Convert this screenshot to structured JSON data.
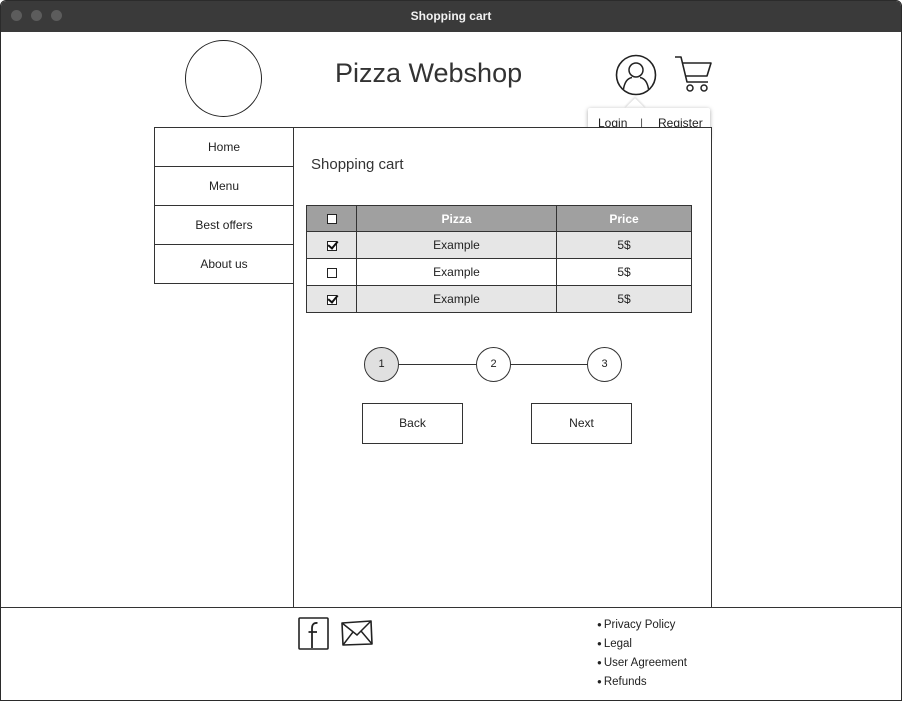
{
  "window": {
    "title": "Shopping cart"
  },
  "header": {
    "site_title": "Pizza Webshop",
    "icons": {
      "user": "user-icon",
      "cart": "cart-icon",
      "logo": "logo-placeholder"
    }
  },
  "account_popover": {
    "login": "Login",
    "separator": "|",
    "register": "Register"
  },
  "sidebar": {
    "items": [
      {
        "label": "Home"
      },
      {
        "label": "Menu"
      },
      {
        "label": "Best offers"
      },
      {
        "label": "About us"
      }
    ]
  },
  "main": {
    "title": "Shopping cart",
    "table": {
      "columns": [
        "",
        "Pizza",
        "Price"
      ],
      "header_checked": false,
      "rows": [
        {
          "checked": true,
          "pizza": "Example",
          "price": "5$"
        },
        {
          "checked": false,
          "pizza": "Example",
          "price": "5$"
        },
        {
          "checked": true,
          "pizza": "Example",
          "price": "5$"
        }
      ]
    },
    "stepper": {
      "steps": [
        "1",
        "2",
        "3"
      ],
      "current": 1
    },
    "buttons": {
      "back": "Back",
      "next": "Next"
    }
  },
  "footer": {
    "icons": {
      "facebook": "facebook-icon",
      "mail": "mail-icon"
    },
    "links": [
      "Privacy Policy",
      "Legal",
      "User Agreement",
      "Refunds"
    ]
  },
  "colors": {
    "titlebar": "#3a3a3a",
    "table_header": "#a0a0a0",
    "row_shade": "#e6e6e6",
    "active_step": "#e0e0e0"
  }
}
